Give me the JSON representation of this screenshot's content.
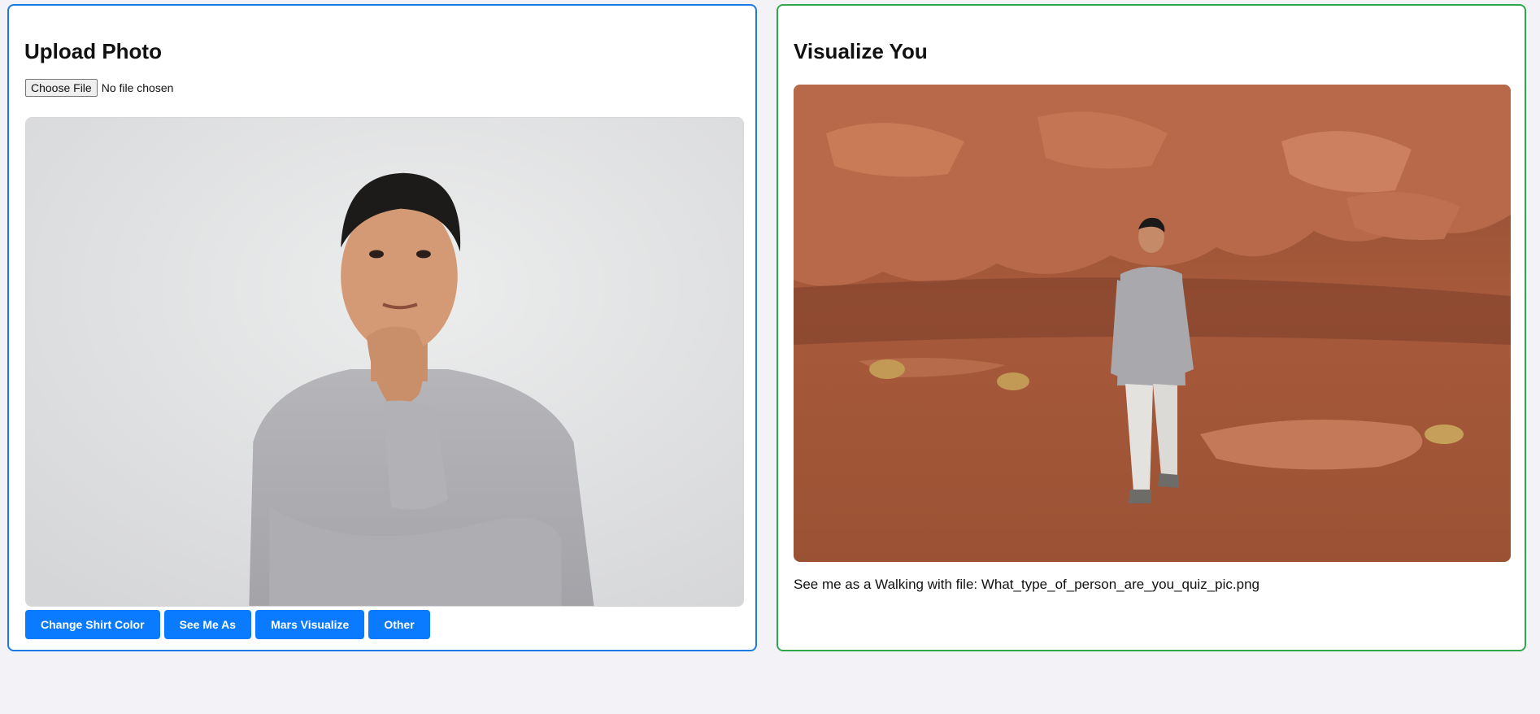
{
  "upload": {
    "title": "Upload Photo",
    "choose_file_label": "Choose File",
    "file_status": "No file chosen",
    "buttons": [
      "Change Shirt Color",
      "See Me As",
      "Mars Visualize",
      "Other"
    ]
  },
  "visualize": {
    "title": "Visualize You",
    "result_text": "See me as a Walking with file: What_type_of_person_are_you_quiz_pic.png"
  },
  "colors": {
    "left_border": "#1a7ae8",
    "right_border": "#2ea84a",
    "button_bg": "#0a7bff",
    "page_bg": "#f3f3f7"
  }
}
